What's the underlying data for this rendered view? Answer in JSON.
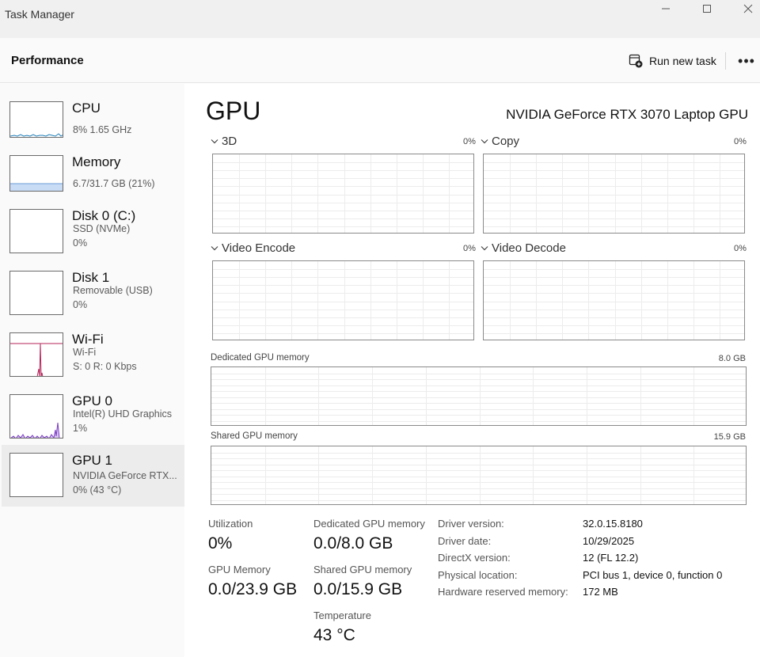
{
  "window": {
    "title": "Task Manager",
    "controls": [
      "minimize-icon",
      "maximize-icon",
      "close-icon"
    ]
  },
  "header": {
    "page_title": "Performance",
    "run_new_task": "Run new task",
    "more": "•••"
  },
  "sidebar": {
    "items": [
      {
        "name": "CPU",
        "line1": "8%  1.65 GHz",
        "line2": "",
        "thumb_color": "#1f7fb7"
      },
      {
        "name": "Memory",
        "line1": "6.7/31.7 GB (21%)",
        "line2": "",
        "thumb_color": "#7a3fb8"
      },
      {
        "name": "Disk 0 (C:)",
        "line1": "SSD (NVMe)",
        "line2": "0%",
        "thumb_color": "#4d9a2a"
      },
      {
        "name": "Disk 1",
        "line1": "Removable (USB)",
        "line2": "0%",
        "thumb_color": "#4d9a2a"
      },
      {
        "name": "Wi-Fi",
        "line1": "Wi-Fi",
        "line2": "S: 0 R: 0 Kbps",
        "thumb_color": "#b5265a"
      },
      {
        "name": "GPU 0",
        "line1": "Intel(R) UHD Graphics",
        "line2": "1%",
        "thumb_color": "#7b3cc4"
      },
      {
        "name": "GPU 1",
        "line1": "NVIDIA GeForce RTX...",
        "line2": "0% (43 °C)",
        "thumb_color": "#7b3cc4"
      }
    ],
    "selected": 6
  },
  "main": {
    "heading": "GPU",
    "model": "NVIDIA GeForce RTX 3070 Laptop GPU",
    "engines": [
      {
        "name": "3D",
        "pct": "0%"
      },
      {
        "name": "Copy",
        "pct": "0%"
      },
      {
        "name": "Video Encode",
        "pct": "0%"
      },
      {
        "name": "Video Decode",
        "pct": "0%"
      }
    ],
    "dedicated_mem": {
      "label": "Dedicated GPU memory",
      "max": "8.0 GB"
    },
    "shared_mem": {
      "label": "Shared GPU memory",
      "max": "15.9 GB"
    },
    "stats": {
      "utilization": {
        "label": "Utilization",
        "value": "0%"
      },
      "dedicated": {
        "label": "Dedicated GPU memory",
        "value": "0.0/8.0 GB"
      },
      "gpu_memory": {
        "label": "GPU Memory",
        "value": "0.0/23.9 GB"
      },
      "shared": {
        "label": "Shared GPU memory",
        "value": "0.0/15.9 GB"
      },
      "temperature": {
        "label": "Temperature",
        "value": "43 °C"
      }
    },
    "info": [
      {
        "key": "Driver version:",
        "value": "32.0.15.8180"
      },
      {
        "key": "Driver date:",
        "value": "10/29/2025"
      },
      {
        "key": "DirectX version:",
        "value": "12 (FL 12.2)"
      },
      {
        "key": "Physical location:",
        "value": "PCI bus 1, device 0, function 0"
      },
      {
        "key": "Hardware reserved memory:",
        "value": "172 MB"
      }
    ]
  }
}
